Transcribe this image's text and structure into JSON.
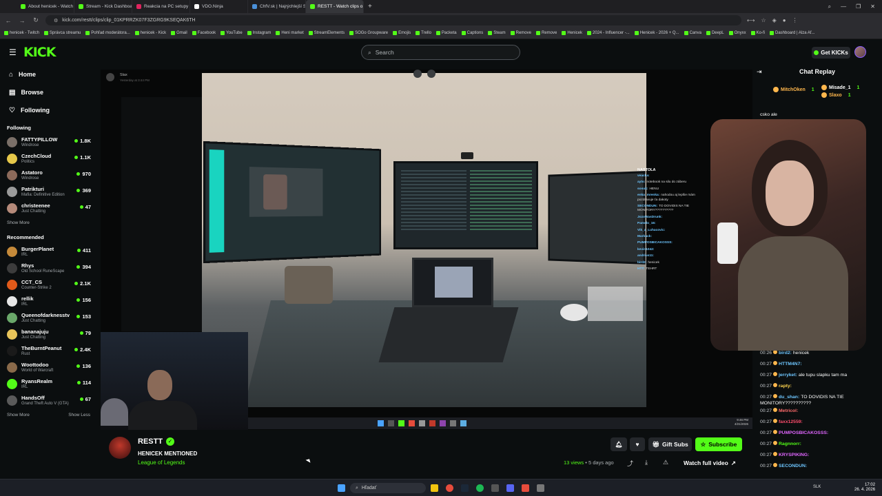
{
  "browser": {
    "tabs": [
      {
        "label": "About henicek - Watch Li...",
        "color": "#53fc18"
      },
      {
        "label": "Stream - Kick Dashboard",
        "color": "#53fc18"
      },
      {
        "label": "Reakcia na PC setupy na ...",
        "color": "#e0245e"
      },
      {
        "label": "VDO.Ninja",
        "color": "#ffffff"
      },
      {
        "label": "ChfV.sk | Najrýchlejší Scra...",
        "color": "#4a90d9"
      },
      {
        "label": "RESTT - Watch clips o...",
        "color": "#53fc18"
      }
    ],
    "new_tab": "+",
    "url": "kick.com/restt/clips/clip_01KPRRZK07F3ZGRG9KSEQAK6TH",
    "bookmarks": [
      "henicek - Twitch",
      "Správca streamu",
      "Pohľad moderátora...",
      "henicek - Kick",
      "Gmail",
      "Facebook",
      "YouTube",
      "Instagram",
      "Heni market",
      "StreamElements",
      "SOGo Groupware",
      "Emojis",
      "Trello",
      "Packeta",
      "Captions",
      "Steam",
      "Remove",
      "Remove",
      "Henicek",
      "2024 - Influencer -...",
      "Henicek - 2026 + Q...",
      "Canva",
      "DeepL",
      "Onyxx",
      "Ko-fi",
      "Dashboard | Alza Af..."
    ]
  },
  "header": {
    "logo": "KICK",
    "search_placeholder": "Search",
    "get_kicks": "Get KICKs"
  },
  "sidebar": {
    "nav": [
      {
        "label": "Home",
        "icon": "home-icon"
      },
      {
        "label": "Browse",
        "icon": "browse-icon"
      },
      {
        "label": "Following",
        "icon": "heart-icon"
      }
    ],
    "following_title": "Following",
    "following": [
      {
        "name": "FATTYPILLOW",
        "category": "Windrose",
        "viewers": "1.8K",
        "color": "#7a6f68"
      },
      {
        "name": "CzechCloud",
        "category": "Politics",
        "viewers": "1.1K",
        "color": "#e6c84a"
      },
      {
        "name": "Astatoro",
        "category": "Windrose",
        "viewers": "970",
        "color": "#8c6a5a"
      },
      {
        "name": "Patrikturi",
        "category": "Mafia: Definitive Edition",
        "viewers": "369",
        "color": "#9a9a9a"
      },
      {
        "name": "christeenee",
        "category": "Just Chatting",
        "viewers": "47",
        "color": "#b58a7a"
      }
    ],
    "show_more": "Show More",
    "recommended_title": "Recommended",
    "recommended": [
      {
        "name": "BurgerPlanet",
        "category": "IRL",
        "viewers": "411",
        "color": "#c58a3a"
      },
      {
        "name": "Rhys",
        "category": "Old School RuneScape",
        "viewers": "394",
        "color": "#3c3c3c"
      },
      {
        "name": "CCT_CS",
        "category": "Counter-Strike 2",
        "viewers": "2.1K",
        "color": "#e05a1a"
      },
      {
        "name": "rellik",
        "category": "IRL",
        "viewers": "156",
        "color": "#e6e6e6"
      },
      {
        "name": "Queenofdarknesstv",
        "category": "Just Chatting",
        "viewers": "153",
        "color": "#6aa86a"
      },
      {
        "name": "bananajuju",
        "category": "Just Chatting",
        "viewers": "79",
        "color": "#e8c45a"
      },
      {
        "name": "TheBurntPeanut",
        "category": "Rust",
        "viewers": "2.4K",
        "color": "#1a1a1a"
      },
      {
        "name": "Woottodoo",
        "category": "World of Warcraft",
        "viewers": "136",
        "color": "#8a6a4a"
      },
      {
        "name": "RyansRealm",
        "category": "IRL",
        "viewers": "114",
        "color": "#53fc18"
      },
      {
        "name": "HandsOff",
        "category": "Grand Theft Auto V (GTA)",
        "viewers": "67",
        "color": "#5a5a5a"
      }
    ],
    "show_more_2": "Show More",
    "show_less": "Show Less"
  },
  "video": {
    "overlay_user": "Slax",
    "overlay_time": "Yesterday at 3:44 PM",
    "inner_chat_title": "NASTOLA",
    "inner_chat": [
      {
        "user": "veacka:",
        "msg": ""
      },
      {
        "user": "ayto:",
        "msg": "notebook na silu do záberu"
      },
      {
        "user": "sosuk:",
        "msg": "HENU"
      },
      {
        "user": "enka_mrenka:",
        "msg": "nahodou aj lepšie mám pozdravuje ťa dakoty"
      },
      {
        "user": "SECONDUN:",
        "msg": "TO DOVIDIS NA TIE MONITORY??????????"
      },
      {
        "user": "JozoWasDrunk:",
        "msg": ""
      },
      {
        "user": "Pamelo_16:",
        "msg": ""
      },
      {
        "user": "Vik_a_Luhacovic:",
        "msg": ""
      },
      {
        "user": "Marback:",
        "msg": ""
      },
      {
        "user": "PUMPOSBICAKOSSS:",
        "msg": ""
      },
      {
        "user": "kevin1042:",
        "msg": ""
      },
      {
        "user": "andrius11:",
        "msg": ""
      },
      {
        "user": "bird2:",
        "msg": "henicek"
      },
      {
        "user": "HTT:",
        "msg": "TEHRT"
      }
    ],
    "inner_time": "9:46 PM",
    "inner_date": "4/21/2026"
  },
  "clip": {
    "streamer": "RESTT",
    "title": "HENICEK MENTIONED",
    "category": "League of Legends",
    "views": "13 views",
    "ago": "5 days ago",
    "gift_subs": "Gift Subs",
    "subscribe": "Subscribe",
    "watch_full": "Watch full video"
  },
  "chat": {
    "title": "Chat Replay",
    "top_gifters": [
      {
        "name": "MitchOken",
        "count": "1",
        "color": "#ffb74d"
      },
      {
        "name": "Misade_1",
        "count": "1",
        "color": "#ffffff"
      },
      {
        "name": "Slaxo",
        "count": "1",
        "color": "#ffb74d"
      }
    ],
    "pinned_fragment": "csko ale",
    "messages": [
      {
        "time": "00:26",
        "user": "bird2:",
        "msg": "henicek",
        "color": "#6ec6ff"
      },
      {
        "time": "00:27",
        "user": "HTTM4N7:",
        "msg": "",
        "color": "#6ec6ff"
      },
      {
        "time": "00:27",
        "user": "jerryket:",
        "msg": "ale tupu slapku tam ma",
        "color": "#6ec6ff"
      },
      {
        "time": "00:27",
        "user": "rapty:",
        "msg": "",
        "color": "#ffd54f"
      },
      {
        "time": "00:27",
        "user": "du_shan:",
        "msg": "TO DOVIDIS NA TIE MONITORY??????????",
        "color": "#6ec6ff"
      },
      {
        "time": "00:27",
        "user": "Metricol:",
        "msg": "",
        "color": "#ff6b6b"
      },
      {
        "time": "00:27",
        "user": "faxx12559:",
        "msg": "",
        "color": "#ff4d6d"
      },
      {
        "time": "00:27",
        "user": "PUMPOSBICAKOSSS:",
        "msg": "",
        "color": "#e066ff"
      },
      {
        "time": "00:27",
        "user": "Ragnnorr:",
        "msg": "",
        "color": "#53fc18"
      },
      {
        "time": "00:27",
        "user": "KRYSPIKING:",
        "msg": "",
        "color": "#e066ff"
      },
      {
        "time": "00:27",
        "user": "SECONDUN:",
        "msg": "",
        "color": "#6ec6ff"
      }
    ]
  },
  "taskbar": {
    "search_placeholder": "Hľadať",
    "lang": "SLK",
    "time": "17:02",
    "date": "26. 4. 2026"
  },
  "colors": {
    "accent": "#53fc18",
    "bg": "#0b0e0f"
  }
}
